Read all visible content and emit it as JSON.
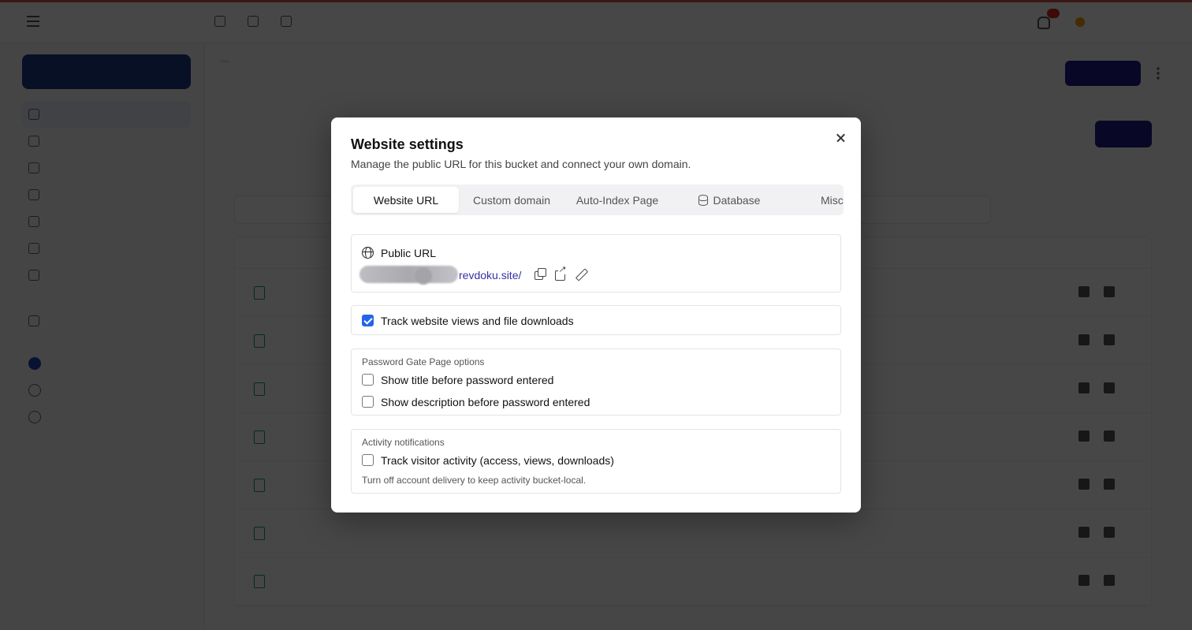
{
  "modal": {
    "title": "Website settings",
    "description": "Manage the public URL for this bucket and connect your own domain.",
    "tabs": [
      {
        "label": "Website URL",
        "active": true
      },
      {
        "label": "Custom domain",
        "active": false
      },
      {
        "label": "Auto-Index Page",
        "active": false
      },
      {
        "label": "Database",
        "active": false,
        "icon": "database-icon"
      },
      {
        "label": "Misc",
        "active": false
      }
    ],
    "public_url": {
      "label": "Public URL",
      "link_text": "revdoku.site/"
    },
    "track_views": {
      "label": "Track website views and file downloads",
      "checked": true
    },
    "password_gate": {
      "heading": "Password Gate Page options",
      "options": [
        {
          "label": "Show title before password entered",
          "checked": false
        },
        {
          "label": "Show description before password entered",
          "checked": false
        }
      ]
    },
    "activity": {
      "heading": "Activity notifications",
      "option": {
        "label": "Track visitor activity (access, views, downloads)",
        "checked": false
      },
      "hint": "Turn off account delivery to keep activity bucket-local."
    }
  },
  "colors": {
    "accent": "#2563eb",
    "link": "#3730a3",
    "primary_dark": "#1e1b8a"
  }
}
